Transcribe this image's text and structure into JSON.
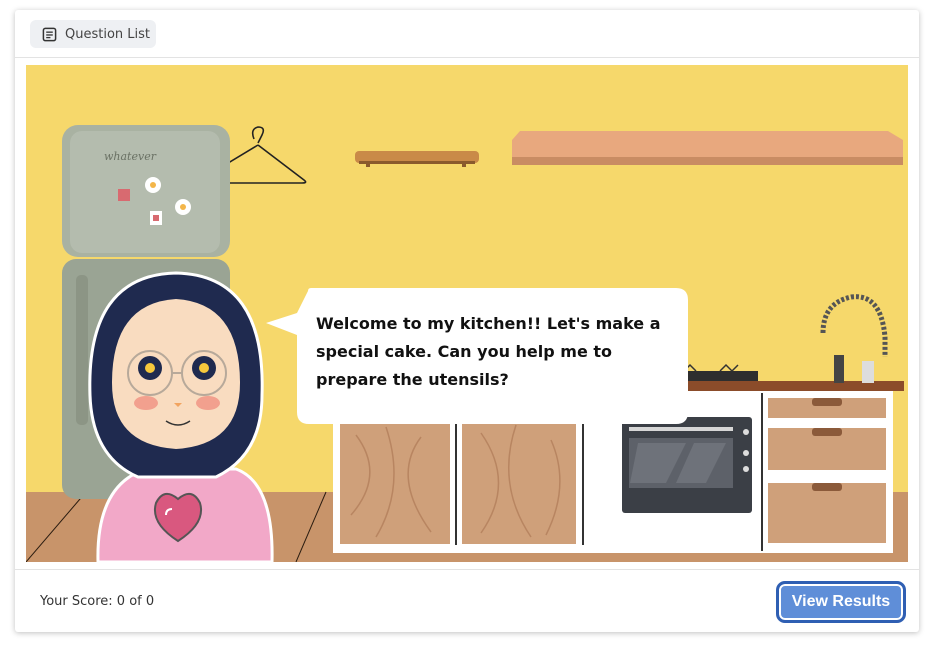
{
  "toolbar": {
    "question_list_label": "Question List",
    "question_list_icon": "list-document-icon"
  },
  "scene": {
    "dialogue": "Welcome to my kitchen!! Let's make a special cake. Can you help me to prepare the utensils?",
    "fridge_note": "whatever",
    "colors": {
      "wall": "#f6d86b",
      "floor": "#c8946a",
      "cabinet_wood": "#cfa07a",
      "shirt": "#f2a8c8",
      "hijab": "#1f2a4f"
    }
  },
  "footer": {
    "score_label": "Your Score: 0 of 0",
    "view_results_label": "View Results",
    "accent": "#5f8ed8"
  }
}
